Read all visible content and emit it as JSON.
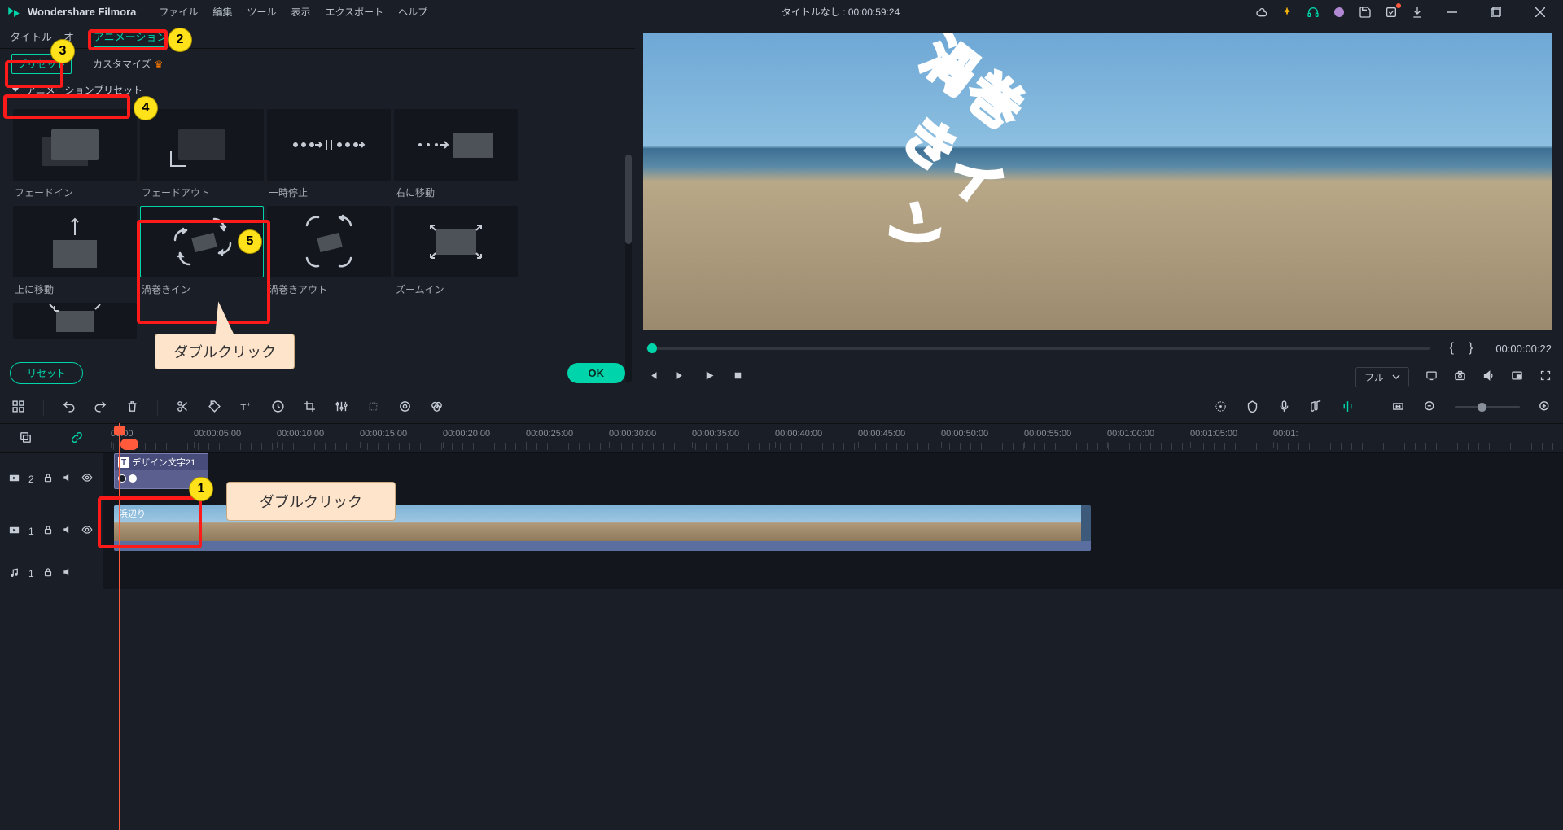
{
  "app": {
    "name": "Wondershare Filmora"
  },
  "menu": [
    "ファイル",
    "編集",
    "ツール",
    "表示",
    "エクスポート",
    "ヘルプ"
  ],
  "title_center": "タイトルなし : 00:00:59:24",
  "panel_tabs": {
    "title": "タイトル",
    "video": "オ",
    "animation": "アニメーション"
  },
  "sub_tabs": {
    "preset": "プリセット",
    "customize": "カスタマイズ"
  },
  "section": "アニメーションプリセット",
  "presets": {
    "fadein": "フェードイン",
    "fadeout": "フェードアウト",
    "pause": "一時停止",
    "moveright": "右に移動",
    "moveup": "上に移動",
    "spiralin": "渦巻きイン",
    "spiralout": "渦巻きアウト",
    "zoomin": "ズームイン"
  },
  "buttons": {
    "reset": "リセット",
    "ok": "OK"
  },
  "preview": {
    "brackets_l": "{",
    "brackets_r": "}",
    "time": "00:00:00:22",
    "quality": "フル"
  },
  "overlay_text": {
    "c1": "渦",
    "c2": "巻",
    "c3": "き",
    "c4": "イ",
    "c5": "ン"
  },
  "ruler": [
    "00:00",
    "00:00:05:00",
    "00:00:10:00",
    "00:00:15:00",
    "00:00:20:00",
    "00:00:25:00",
    "00:00:30:00",
    "00:00:35:00",
    "00:00:40:00",
    "00:00:45:00",
    "00:00:50:00",
    "00:00:55:00",
    "00:01:00:00",
    "00:01:05:00",
    "00:01:"
  ],
  "tracks": {
    "t2": "2",
    "t1": "1",
    "a1": "1"
  },
  "clips": {
    "title": "デザイン文字21",
    "video": "浜辺り"
  },
  "annotations": {
    "num1": "1",
    "num2": "2",
    "num3": "3",
    "num4": "4",
    "num5": "5",
    "dblclick": "ダブルクリック"
  }
}
